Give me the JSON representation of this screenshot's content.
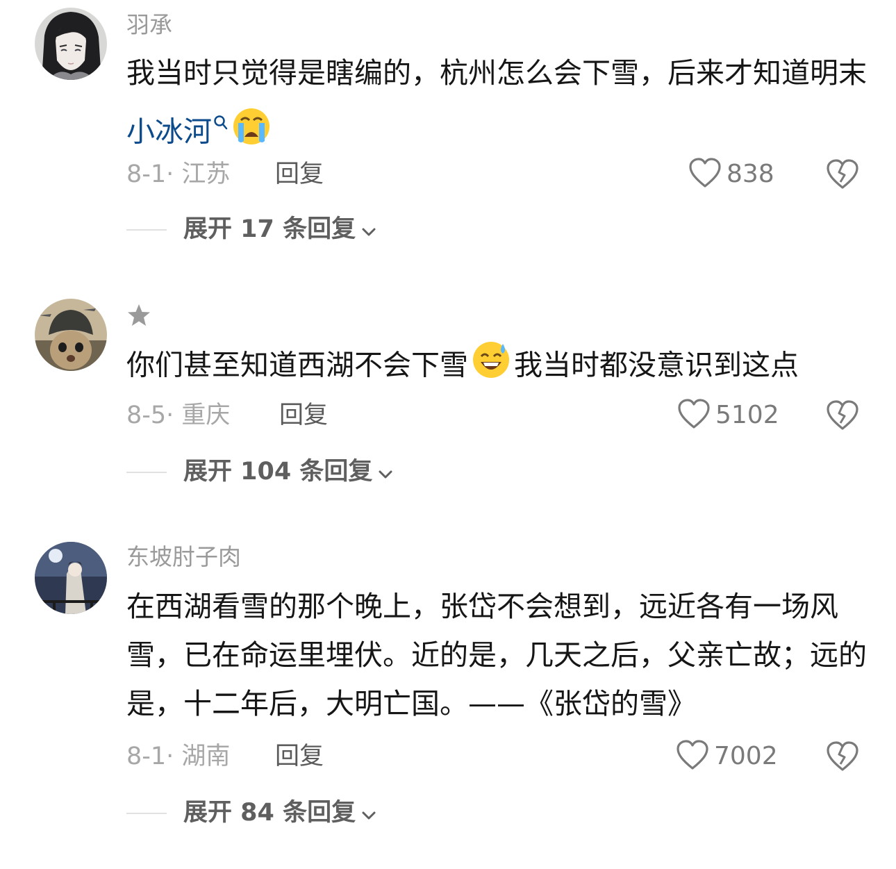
{
  "comments": [
    {
      "username": "羽承",
      "text_before": "我当时只觉得是瞎编的，杭州怎么会下雪，后来才知道明末",
      "link_text": "小冰河",
      "text_after": "",
      "emoji": "loudly-crying-face-emoji",
      "date_location": "8-1· 江苏",
      "reply_label": "回复",
      "likes": "838",
      "expand_label": "展开 17 条回复"
    },
    {
      "username": "★",
      "text_before": "你们甚至知道西湖不会下雪",
      "emoji": "grinning-sweat-face-emoji",
      "text_after": "我当时都没意识到这点",
      "date_location": "8-5· 重庆",
      "reply_label": "回复",
      "likes": "5102",
      "expand_label": "展开 104 条回复"
    },
    {
      "username": "东坡肘子肉",
      "text": "在西湖看雪的那个晚上，张岱不会想到，远近各有一场风雪，已在命运里埋伏。近的是，几天之后，父亲亡故；远的是，十二年后，大明亡国。——《张岱的雪》",
      "date_location": "8-1· 湖南",
      "reply_label": "回复",
      "likes": "7002",
      "expand_label": "展开 84 条回复"
    }
  ],
  "icons": {
    "like": "heart-outline-icon",
    "dislike": "broken-heart-icon",
    "expand": "chevron-down-icon",
    "search": "search-icon"
  },
  "colors": {
    "link": "#0b4a8b",
    "username": "#9a9a9a",
    "meta": "#a7a7a7"
  }
}
